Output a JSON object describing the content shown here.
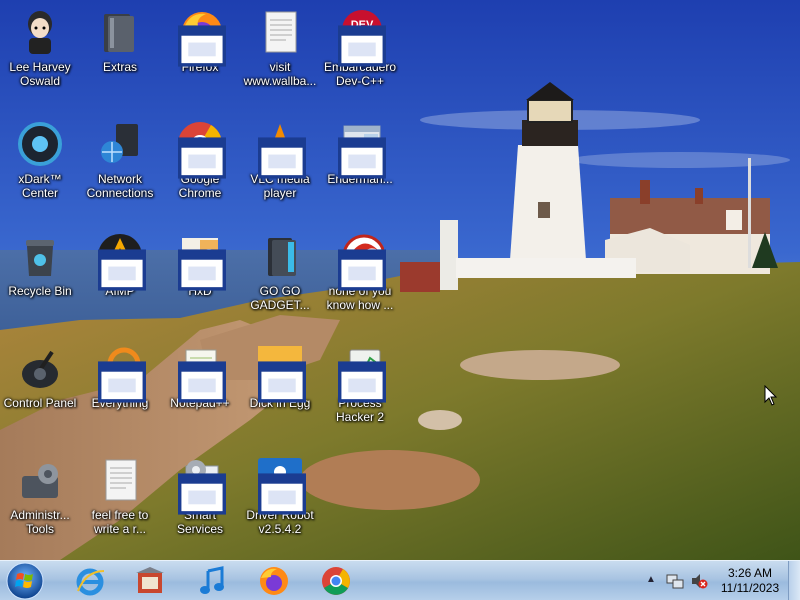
{
  "desktop": {
    "icons": [
      {
        "label": "Lee Harvey Oswald",
        "icon": "person-icon"
      },
      {
        "label": "Extras",
        "icon": "folder-icon"
      },
      {
        "label": "Firefox",
        "icon": "firefox-icon"
      },
      {
        "label": "visit www.wallba...",
        "icon": "document-icon"
      },
      {
        "label": "Embarcadero Dev-C++",
        "icon": "devcpp-icon"
      },
      {
        "label": "xDark™ Center",
        "icon": "xdark-icon"
      },
      {
        "label": "Network Connections",
        "icon": "network-icon"
      },
      {
        "label": "Google Chrome",
        "icon": "chrome-icon"
      },
      {
        "label": "VLC media player",
        "icon": "vlc-icon"
      },
      {
        "label": "Enderman...",
        "icon": "window-icon"
      },
      {
        "label": "Recycle Bin",
        "icon": "recycle-bin-icon"
      },
      {
        "label": "AIMP",
        "icon": "aimp-icon"
      },
      {
        "label": "HxD",
        "icon": "hxd-icon"
      },
      {
        "label": "GO GO GADGET...",
        "icon": "gadget-icon"
      },
      {
        "label": "none of you know how ...",
        "icon": "red-app-icon"
      },
      {
        "label": "Control Panel",
        "icon": "control-panel-icon"
      },
      {
        "label": "Everything",
        "icon": "everything-icon"
      },
      {
        "label": "Notepad++",
        "icon": "notepad-icon"
      },
      {
        "label": "Dick in Egg",
        "icon": "egg-icon"
      },
      {
        "label": "Process Hacker 2",
        "icon": "process-hacker-icon"
      },
      {
        "label": "Administr... Tools",
        "icon": "admin-tools-icon"
      },
      {
        "label": "feel free to write a r...",
        "icon": "text-file-icon"
      },
      {
        "label": "Smart Services",
        "icon": "services-icon"
      },
      {
        "label": "Driver Robot v2.5.4.2",
        "icon": "driver-robot-icon"
      }
    ]
  },
  "taskbar": {
    "start_icon": "windows-orb-icon",
    "pinned": [
      {
        "name": "internet-explorer-icon"
      },
      {
        "name": "store-icon"
      },
      {
        "name": "music-icon"
      },
      {
        "name": "firefox-icon"
      },
      {
        "name": "chrome-icon"
      }
    ],
    "tray": {
      "arrow": "▲",
      "icons": [
        "network-tray-icon",
        "volume-muted-icon"
      ]
    },
    "clock": {
      "time": "3:26 AM",
      "date": "11/11/2023"
    }
  }
}
